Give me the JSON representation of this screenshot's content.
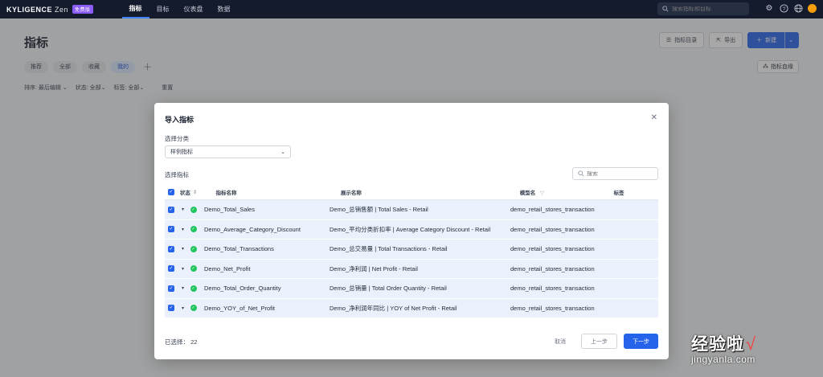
{
  "topbar": {
    "brand": "KYLIGENCE",
    "brand_suffix": "Zen",
    "edition_badge": "免费版",
    "tabs": [
      {
        "label": "指标",
        "active": true
      },
      {
        "label": "目标",
        "active": false
      },
      {
        "label": "仪表盘",
        "active": false
      },
      {
        "label": "数据",
        "active": false
      }
    ],
    "search_placeholder": "搜索指标和目标",
    "icons": [
      "gear-icon",
      "help-icon",
      "globe-icon",
      "avatar"
    ]
  },
  "page": {
    "title": "指标",
    "actions": {
      "catalog": "指标目录",
      "export": "导出",
      "new": "新建"
    },
    "subtabs": [
      {
        "label": "推荐",
        "active": false
      },
      {
        "label": "全部",
        "active": false
      },
      {
        "label": "收藏",
        "active": false
      },
      {
        "label": "我的",
        "active": true
      }
    ],
    "metric_map": "指标血缘",
    "filters": {
      "sort_label": "排序:",
      "sort_value": "最后编辑",
      "status_label": "状态:",
      "status_value": "全部",
      "tag_label": "标签:",
      "tag_value": "全部",
      "reset": "重置"
    }
  },
  "modal": {
    "title": "导入指标",
    "category_label": "选择分类",
    "category_value": "样例指标",
    "metrics_label": "选择指标",
    "search_placeholder": "搜索",
    "columns": {
      "status": "状态",
      "name": "指标名称",
      "display": "展示名称",
      "model": "模型名",
      "tag": "标签"
    },
    "rows": [
      {
        "name": "Demo_Total_Sales",
        "display": "Demo_总销售额 | Total Sales - Retail",
        "model": "demo_retail_stores_transaction",
        "tag": ""
      },
      {
        "name": "Demo_Average_Category_Discount",
        "display": "Demo_平均分类折扣率 | Average Category Discount - Retail",
        "model": "demo_retail_stores_transaction",
        "tag": ""
      },
      {
        "name": "Demo_Total_Transactions",
        "display": "Demo_总交易量 | Total Transactions - Retail",
        "model": "demo_retail_stores_transaction",
        "tag": ""
      },
      {
        "name": "Demo_Net_Profit",
        "display": "Demo_净利润 | Net Profit - Retail",
        "model": "demo_retail_stores_transaction",
        "tag": ""
      },
      {
        "name": "Demo_Total_Order_Quantity",
        "display": "Demo_总销量 | Total Order Quantity - Retail",
        "model": "demo_retail_stores_transaction",
        "tag": ""
      },
      {
        "name": "Demo_YOY_of_Net_Profit",
        "display": "Demo_净利润年同比 | YOY of Net Profit - Retail",
        "model": "demo_retail_stores_transaction",
        "tag": ""
      }
    ],
    "selected_label": "已选择：",
    "selected_count": "22",
    "buttons": {
      "cancel": "取消",
      "prev": "上一步",
      "next": "下一步"
    }
  },
  "watermark": {
    "cn": "经验啦",
    "url": "jingyanla.com"
  },
  "colors": {
    "accent": "#2563eb",
    "topbar": "#141b2d",
    "row_selected": "#eaf1fd",
    "success": "#22c55e"
  }
}
